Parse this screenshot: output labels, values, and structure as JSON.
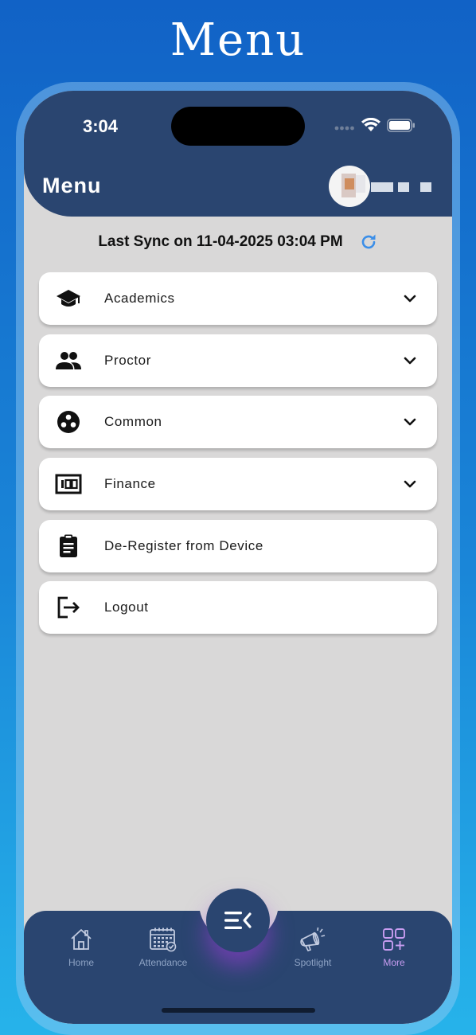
{
  "page_heading": "Menu",
  "status_bar": {
    "time": "3:04"
  },
  "header": {
    "title": "Menu"
  },
  "sync": {
    "text": "Last Sync on 11-04-2025 03:04 PM"
  },
  "menu_items": [
    {
      "label": "Academics",
      "icon": "graduation-cap-icon",
      "expandable": true
    },
    {
      "label": "Proctor",
      "icon": "people-icon",
      "expandable": true
    },
    {
      "label": "Common",
      "icon": "circle-dots-icon",
      "expandable": true
    },
    {
      "label": "Finance",
      "icon": "finance-counter-icon",
      "expandable": true
    },
    {
      "label": "De-Register from Device",
      "icon": "clipboard-icon",
      "expandable": false
    },
    {
      "label": "Logout",
      "icon": "logout-icon",
      "expandable": false
    }
  ],
  "bottom_nav": {
    "items": [
      {
        "label": "Home",
        "icon": "home-icon"
      },
      {
        "label": "Attendance",
        "icon": "calendar-check-icon"
      },
      {
        "label": "Spotlight",
        "icon": "megaphone-icon"
      },
      {
        "label": "More",
        "icon": "grid-plus-icon",
        "active": true
      }
    ]
  },
  "colors": {
    "header_bg": "#2a4570",
    "screen_bg": "#d9d8d8",
    "accent_refresh": "#3b8ee8",
    "active_nav": "#c79cf0",
    "inactive_nav": "#8ea3c4"
  }
}
